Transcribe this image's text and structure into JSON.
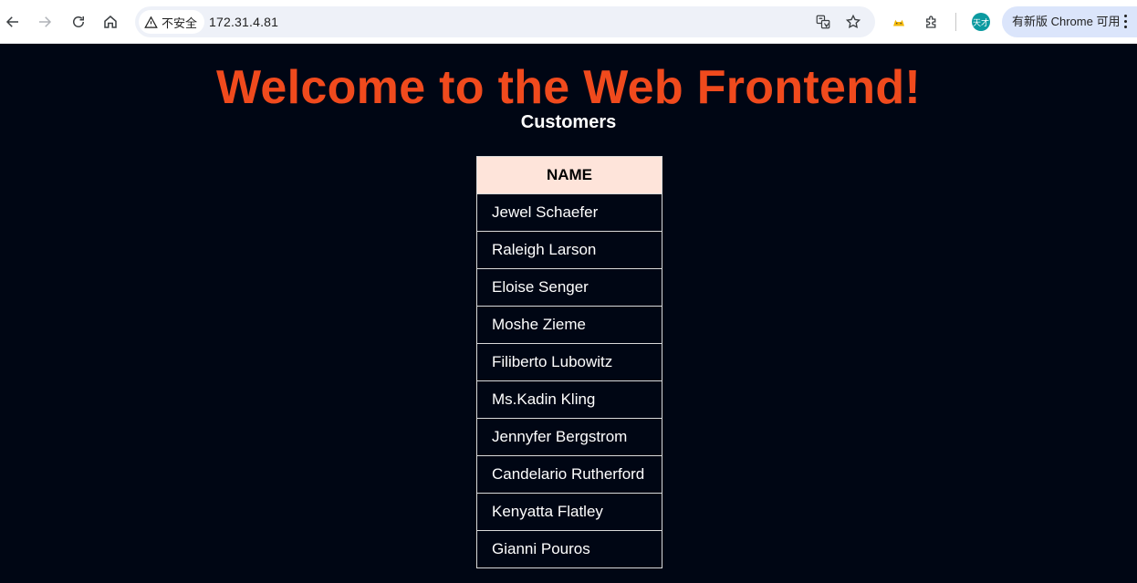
{
  "browser": {
    "security_label": "不安全",
    "url": "172.31.4.81",
    "update_label": "有新版 Chrome 可用",
    "avatar_text": "天才",
    "icons": [
      "back-icon",
      "forward-icon",
      "reload-icon",
      "home-icon",
      "warning-icon",
      "translate-icon",
      "star-icon",
      "extension-cat-icon",
      "extensions-puzzle-icon",
      "menu-kebab-icon"
    ]
  },
  "page": {
    "headline": "Welcome to the Web Frontend!",
    "subtitle": "Customers",
    "colors": {
      "background": "#000614",
      "headline": "#f04a1d",
      "table_header_bg": "#fee4da"
    },
    "table": {
      "header": "NAME",
      "rows": [
        "Jewel Schaefer",
        "Raleigh Larson",
        "Eloise Senger",
        "Moshe Zieme",
        "Filiberto Lubowitz",
        "Ms.Kadin Kling",
        "Jennyfer Bergstrom",
        "Candelario Rutherford",
        "Kenyatta Flatley",
        "Gianni Pouros"
      ]
    }
  }
}
